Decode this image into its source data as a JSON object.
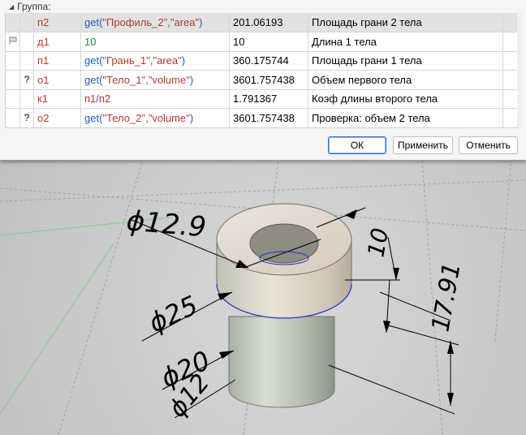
{
  "group_label": "Группа:",
  "rows": [
    {
      "mark": "",
      "name": "п2",
      "expr": [
        {
          "t": "get(",
          "c": "blue"
        },
        {
          "t": "\"Профиль_2\"",
          "c": "red"
        },
        {
          "t": ",",
          "c": "blue"
        },
        {
          "t": "\"area\"",
          "c": "red"
        },
        {
          "t": ")",
          "c": "blue"
        }
      ],
      "value": "201.06193",
      "desc": "Площадь грани 2 тела",
      "selected": true
    },
    {
      "mark": "flag",
      "name": "д1",
      "expr": [
        {
          "t": "10",
          "c": "green"
        }
      ],
      "value": "10",
      "desc": "Длина 1 тела",
      "selected": false
    },
    {
      "mark": "",
      "name": "п1",
      "expr": [
        {
          "t": "get(",
          "c": "blue"
        },
        {
          "t": "\"Грань_1\"",
          "c": "red"
        },
        {
          "t": ",",
          "c": "blue"
        },
        {
          "t": "\"area\"",
          "c": "red"
        },
        {
          "t": ")",
          "c": "blue"
        }
      ],
      "value": "360.175744",
      "desc": "Площадь грани 1 тела",
      "selected": false
    },
    {
      "mark": "?",
      "name": "о1",
      "expr": [
        {
          "t": "get(",
          "c": "blue"
        },
        {
          "t": "\"Тело_1\"",
          "c": "red"
        },
        {
          "t": ",",
          "c": "blue"
        },
        {
          "t": "\"volume\"",
          "c": "red"
        },
        {
          "t": ")",
          "c": "blue"
        }
      ],
      "value": "3601.757438",
      "desc": "Объем первого тела",
      "selected": false
    },
    {
      "mark": "",
      "name": "к1",
      "expr": [
        {
          "t": "п1",
          "c": "red"
        },
        {
          "t": "/",
          "c": "blue"
        },
        {
          "t": "п2",
          "c": "red"
        }
      ],
      "value": "1.791367",
      "desc": "Коэф длины второго тела",
      "selected": false
    },
    {
      "mark": "?",
      "name": "о2",
      "expr": [
        {
          "t": "get(",
          "c": "blue"
        },
        {
          "t": "\"Тело_2\"",
          "c": "red"
        },
        {
          "t": ",",
          "c": "blue"
        },
        {
          "t": "\"volume\"",
          "c": "red"
        },
        {
          "t": ")",
          "c": "blue"
        }
      ],
      "value": "3601.757438",
      "desc": "Проверка: объем 2 тела",
      "selected": false
    }
  ],
  "buttons": {
    "ok": "ОК",
    "apply": "Применить",
    "cancel": "Отменить"
  },
  "dimensions": {
    "d_inner_top": "ϕ12.9",
    "d_outer": "ϕ25",
    "d_lower": "ϕ20",
    "d_hole": "ϕ12",
    "h_top": "10",
    "h_total": "17.91"
  },
  "colors": {
    "selected_row": "#e2e2e2",
    "primary_border": "#2a6fcf",
    "edge_highlight": "#1d2fd8"
  }
}
